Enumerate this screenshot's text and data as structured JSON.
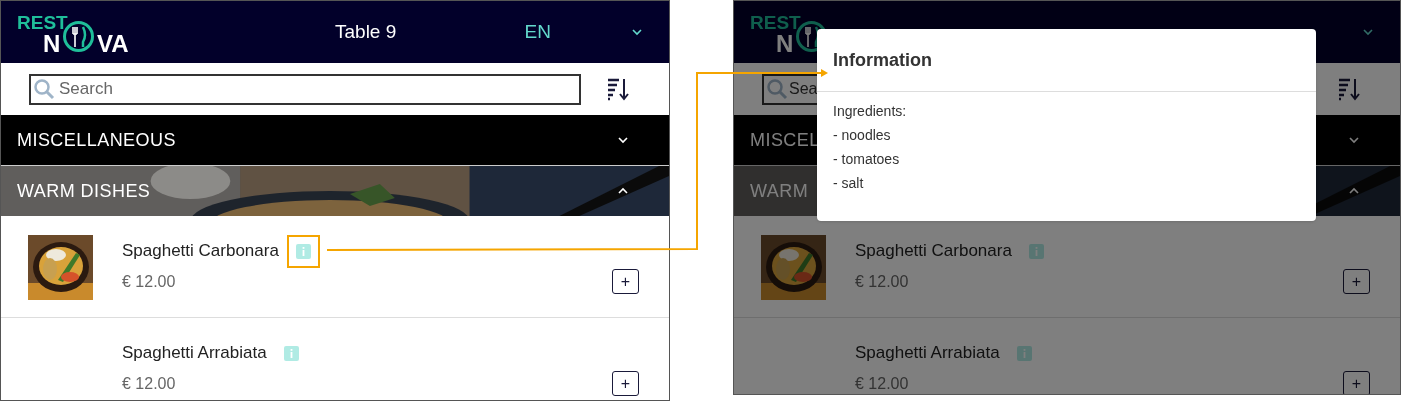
{
  "menu_screen": {
    "logo": {
      "top": "REST",
      "left": "N",
      "right": "VA"
    },
    "table": "Table 9",
    "language": "EN",
    "search": {
      "placeholder": "Search"
    },
    "categories": [
      {
        "name": "MISCELLANEOUS",
        "expanded": false,
        "kind": "plain"
      },
      {
        "name": "WARM DISHES",
        "expanded": true,
        "kind": "picture"
      }
    ],
    "items": [
      {
        "name": "Spaghetti Carbonara",
        "price": "€ 12.00",
        "add_label": "+",
        "has_photo": true,
        "highlighted": true
      },
      {
        "name": "Spaghetti Arrabiata",
        "price": "€ 12.00",
        "add_label": "+",
        "has_photo": false,
        "highlighted": false
      }
    ]
  },
  "dimmed_screen": {
    "logo": {
      "top": "REST",
      "left": "N"
    },
    "search": {
      "placeholder": "Sea"
    },
    "categories": [
      {
        "name": "MISCEL",
        "expanded": false,
        "kind": "plain"
      },
      {
        "name": "WARM",
        "expanded": true,
        "kind": "picture"
      }
    ],
    "items": [
      {
        "name": "Spaghetti Carbonara",
        "price": "€ 12.00",
        "add_label": "+",
        "has_photo": true,
        "highlighted": false
      },
      {
        "name": "Spaghetti Arrabiata",
        "price": "€ 12.00",
        "add_label": "+",
        "has_photo": false,
        "highlighted": false
      }
    ]
  },
  "dialog": {
    "title": "Information",
    "lines": [
      "Ingredients:",
      "- noodles",
      "- tomatoes",
      "- salt"
    ]
  }
}
